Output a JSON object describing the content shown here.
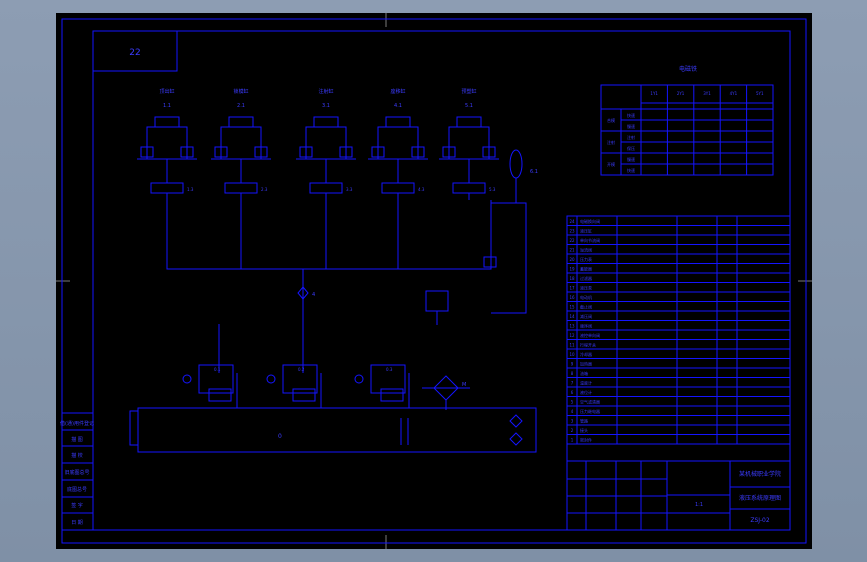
{
  "title_box_text": "22",
  "actuators": [
    {
      "label": "顶出缸",
      "tag": "1.1"
    },
    {
      "label": "锁模缸",
      "tag": "2.1"
    },
    {
      "label": "注射缸",
      "tag": "3.1"
    },
    {
      "label": "座移缸",
      "tag": "4.1"
    },
    {
      "label": "预塑缸",
      "tag": "5.1"
    }
  ],
  "valve_tags": [
    "1.3",
    "2.3",
    "3.3",
    "4.3",
    "5.3"
  ],
  "pump_tags": [
    "0.1",
    "0.2",
    "0.3"
  ],
  "accumulator_tag": "6.1",
  "tank_tag": "0",
  "motor_tag": "M",
  "pressure_gauge_tag": "4",
  "table_title": "电磁铁",
  "table_cols": [
    "1Y1",
    "2Y1",
    "3Y1",
    "4Y1",
    "5Y1"
  ],
  "table_rows": [
    {
      "group": "合模",
      "rows": [
        "快速",
        "慢速"
      ]
    },
    {
      "group": "注射",
      "rows": [
        "注射",
        "保压"
      ]
    },
    {
      "group": "开模",
      "rows": [
        "慢速",
        "快速"
      ]
    }
  ],
  "parts_list": [
    "电磁换向阀",
    "液压缸",
    "单向节流阀",
    "溢流阀",
    "压力表",
    "蓄能器",
    "过滤器",
    "液压泵",
    "电动机",
    "截止阀",
    "减压阀",
    "顺序阀",
    "液控单向阀",
    "行程开关",
    "冷却器",
    "加热器",
    "油箱",
    "温度计",
    "液位计",
    "空气滤清器",
    "压力继电器",
    "管路",
    "接头",
    "密封件"
  ],
  "title_block": {
    "school": "某机械职业学院",
    "drawing_name": "液压系统原理图",
    "drawing_no": "ZSJ-02",
    "scale": "1:1"
  },
  "left_column_labels": [
    "借(通)用件登记",
    "描 图",
    "描 校",
    "旧底图总号",
    "底图总号",
    "签 字",
    "日 期"
  ],
  "colors": {
    "line": "#1414ff",
    "sheet": "#000000",
    "frame": "#8d9db3"
  }
}
